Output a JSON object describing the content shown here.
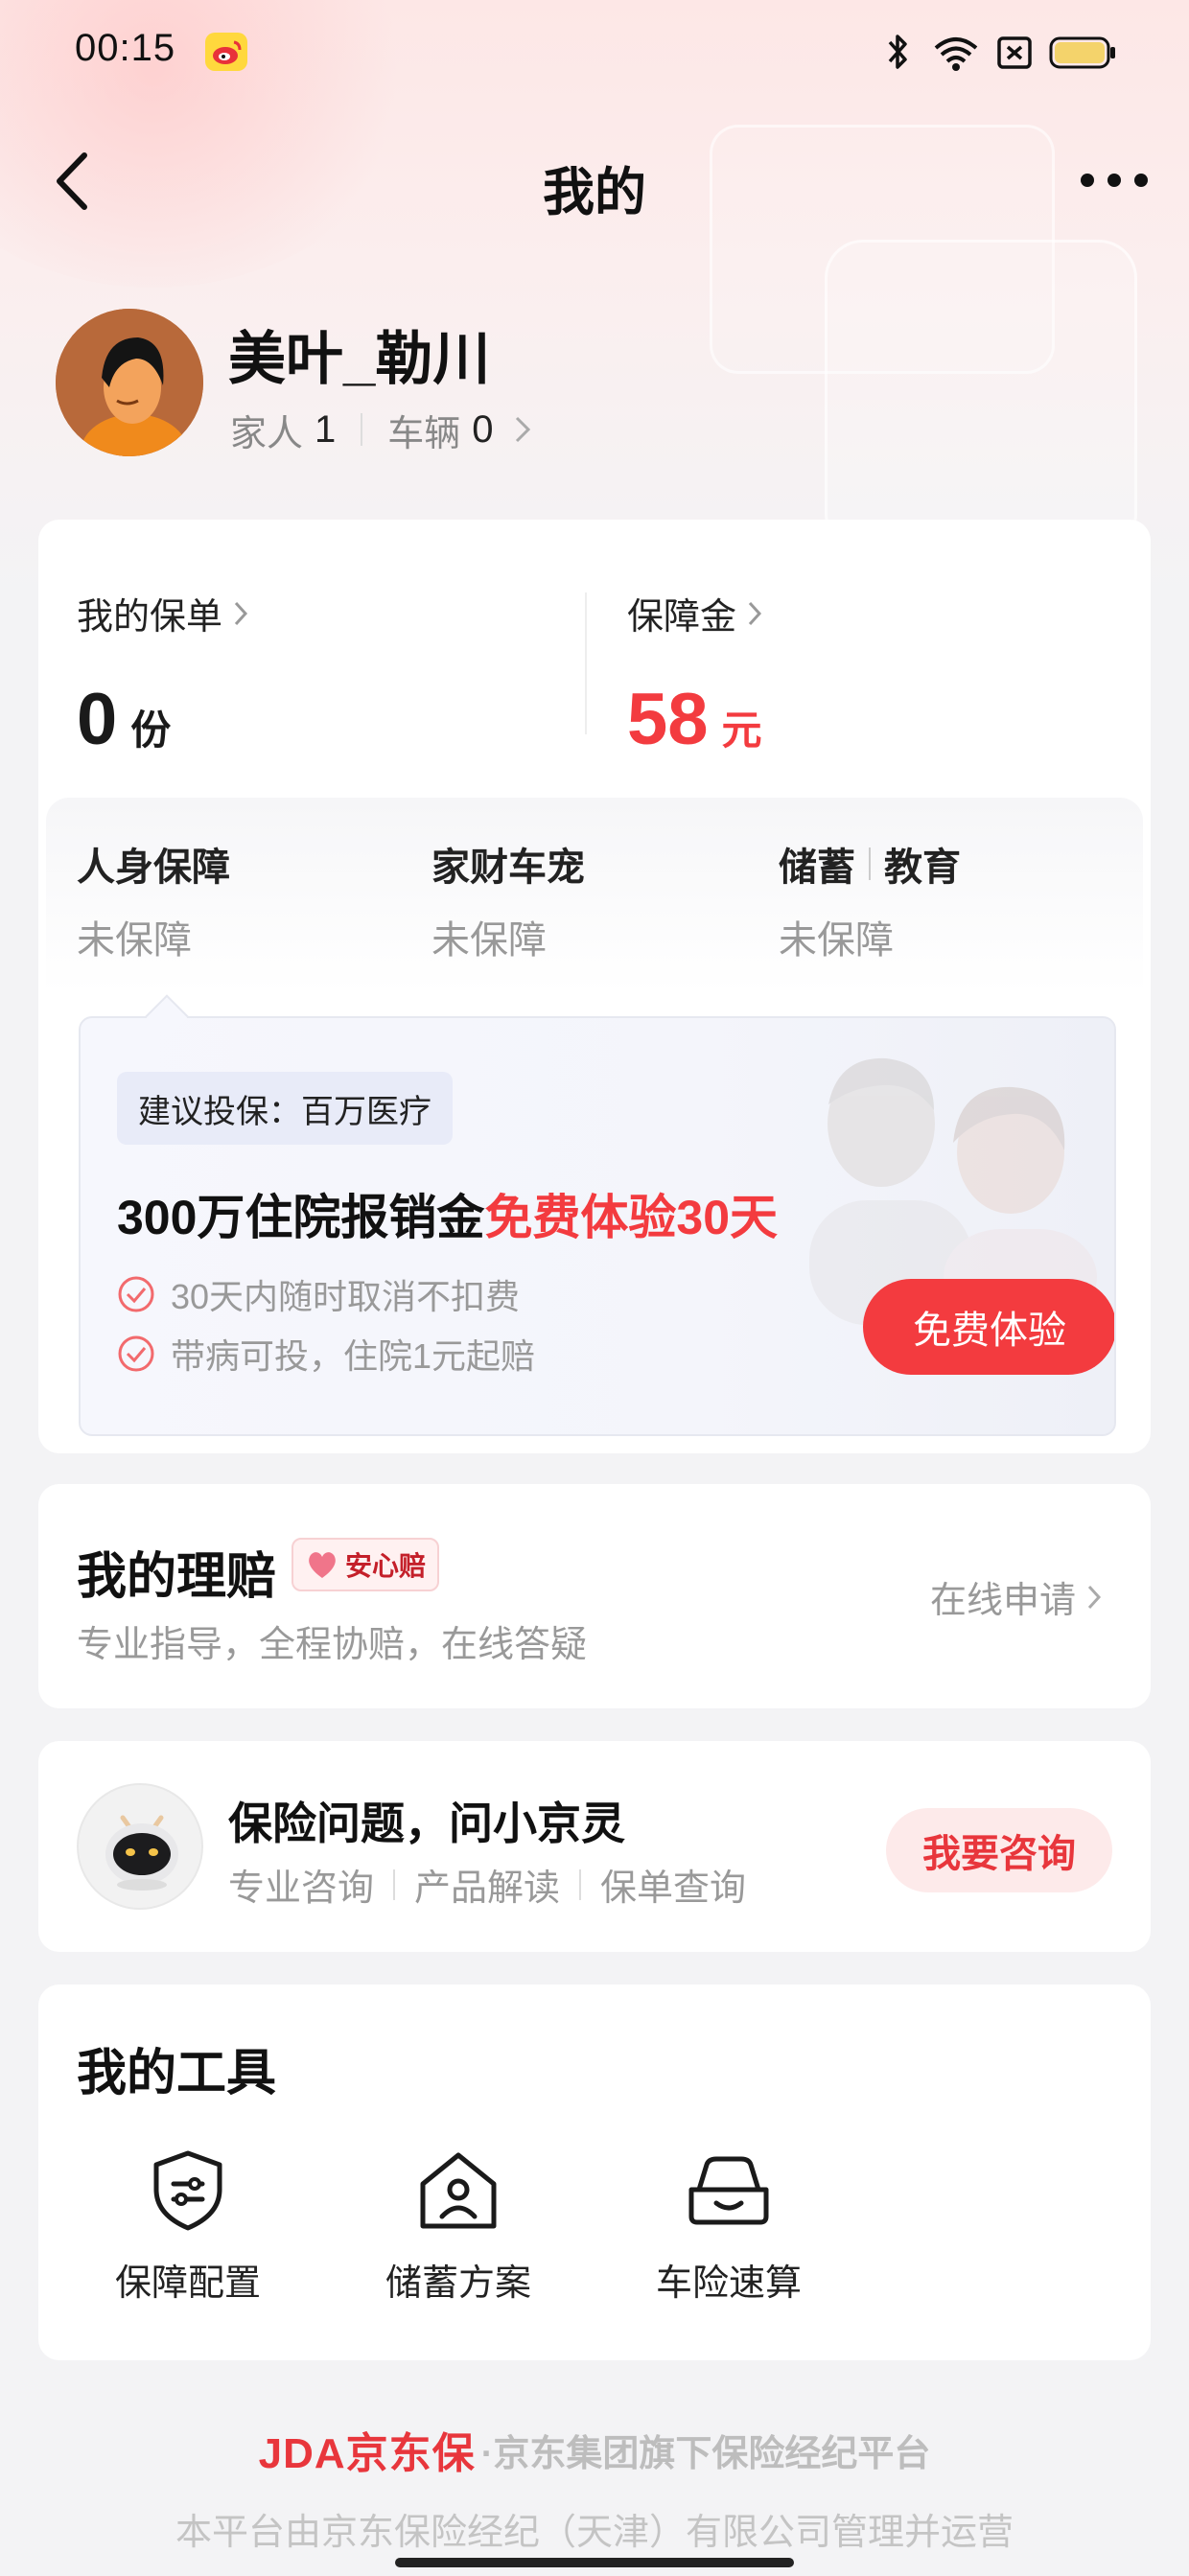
{
  "status_bar": {
    "time": "00:15"
  },
  "nav": {
    "title": "我的"
  },
  "profile": {
    "username": "美叶_勒川",
    "family_label": "家人",
    "family_count": "1",
    "vehicle_label": "车辆",
    "vehicle_count": "0"
  },
  "stats": {
    "policies": {
      "label": "我的保单",
      "value": "0",
      "unit": "份"
    },
    "fund": {
      "label": "保障金",
      "value": "58",
      "unit": "元"
    }
  },
  "coverage": {
    "columns": [
      {
        "title": "人身保障",
        "status": "未保障"
      },
      {
        "title": "家财车宠",
        "status": "未保障"
      },
      {
        "title_a": "储蓄",
        "title_b": "教育",
        "status": "未保障"
      }
    ]
  },
  "promo": {
    "tag": "建议投保：百万医疗",
    "headline_black": "300万住院报销金",
    "headline_red": "免费体验30天",
    "bullets": [
      "30天内随时取消不扣费",
      "带病可投，住院1元起赔"
    ],
    "button": "免费体验"
  },
  "claim": {
    "title": "我的理赔",
    "badge": "安心赔",
    "subtitle": "专业指导，全程协赔，在线答疑",
    "link": "在线申请"
  },
  "assistant": {
    "title": "保险问题，问小京灵",
    "links": [
      "专业咨询",
      "产品解读",
      "保单查询"
    ],
    "button": "我要咨询"
  },
  "tools": {
    "title": "我的工具",
    "items": [
      {
        "label": "保障配置",
        "icon": "shield-config-icon"
      },
      {
        "label": "储蓄方案",
        "icon": "house-person-icon"
      },
      {
        "label": "车险速算",
        "icon": "car-smile-icon"
      }
    ]
  },
  "footer": {
    "logo": "JDA京东保",
    "tagline": "·京东集团旗下保险经纪平台",
    "line2": "本平台由京东保险经纪（天津）有限公司管理并运营"
  },
  "colors": {
    "accent_red": "#f33b3f",
    "background": "#f3f3f5"
  }
}
